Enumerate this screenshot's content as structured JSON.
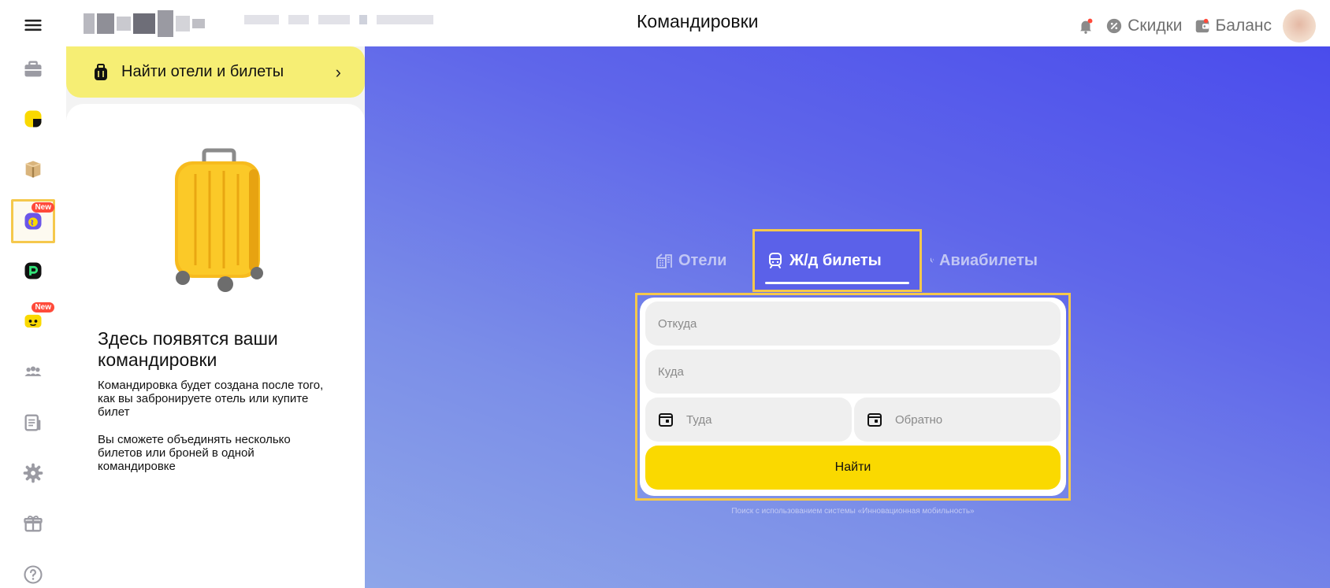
{
  "header": {
    "title": "Командировки",
    "discounts_label": "Скидки",
    "balance_label": "Баланс"
  },
  "sidebar": {
    "items": [
      {
        "icon": "menu-icon"
      },
      {
        "icon": "briefcase-icon"
      },
      {
        "icon": "taxi-icon"
      },
      {
        "icon": "box-icon"
      },
      {
        "icon": "travel-globe-icon",
        "badge": "New"
      },
      {
        "icon": "p-app-icon"
      },
      {
        "icon": "food-icon",
        "badge": "New"
      },
      {
        "icon": "people-icon"
      },
      {
        "icon": "documents-icon"
      },
      {
        "icon": "settings-icon"
      },
      {
        "icon": "gift-icon"
      },
      {
        "icon": "help-icon"
      }
    ]
  },
  "left_panel": {
    "find_button": "Найти отели и билеты",
    "empty_title": "Здесь появятся ваши командировки",
    "empty_text_1": "Командировка будет создана после того, как вы забронируете отель или купите билет",
    "empty_text_2": "Вы сможете объединять несколько билетов или броней в одной командировке"
  },
  "search": {
    "tabs": {
      "hotels": "Отели",
      "trains": "Ж/д билеты",
      "avia": "Авиабилеты"
    },
    "from_placeholder": "Откуда",
    "to_placeholder": "Куда",
    "date_there": "Туда",
    "date_back": "Обратно",
    "submit": "Найти",
    "powered_by": "Поиск с использованием системы «Инновационная мобильность»"
  },
  "colors": {
    "accent_yellow": "#fad900",
    "highlight_outline": "#f5c84c",
    "hero_gradient_start": "#4a4cec",
    "hero_gradient_end": "#8ea6e9",
    "badge_red": "#ff4a3a"
  }
}
